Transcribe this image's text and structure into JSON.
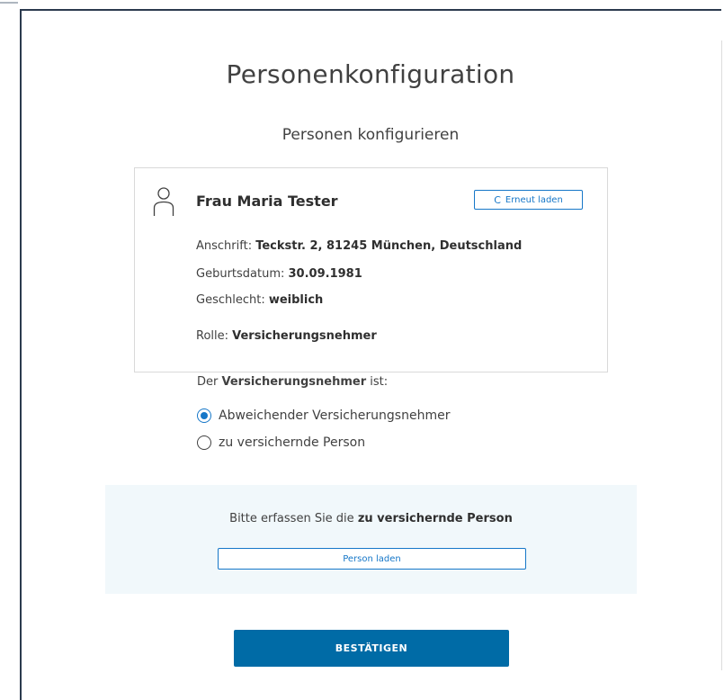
{
  "page": {
    "title": "Personenkonfiguration",
    "subtitle": "Personen konfigurieren"
  },
  "person_card": {
    "icon": "person-icon",
    "name": "Frau Maria Tester",
    "reload_button": {
      "icon": "refresh-icon",
      "icon_glyph": "C",
      "label": "Erneut laden"
    },
    "address_label": "Anschrift: ",
    "address_value": "Teckstr. 2, 81245 München, Deutschland",
    "birthdate_label": "Geburtsdatum: ",
    "birthdate_value": "30.09.1981",
    "gender_label": "Geschlecht: ",
    "gender_value": "weiblich",
    "role_label": "Rolle: ",
    "role_value": "Versicherungsnehmer"
  },
  "policyholder_choice": {
    "question_prefix": "Der ",
    "question_bold": "Versicherungsnehmer",
    "question_suffix": " ist:",
    "options": [
      {
        "label": "Abweichender Versicherungsnehmer",
        "selected": true
      },
      {
        "label": "zu versichernde Person",
        "selected": false
      }
    ]
  },
  "insured_person_section": {
    "prompt_prefix": "Bitte erfassen Sie die ",
    "prompt_bold": "zu versichernde Person",
    "load_button_label": "Person laden"
  },
  "confirm_button_label": "BESTÄTIGEN",
  "colors": {
    "accent": "#1677c8",
    "primary_button": "#006ba6",
    "section_background": "#f1f8fb",
    "text": "#414141"
  }
}
